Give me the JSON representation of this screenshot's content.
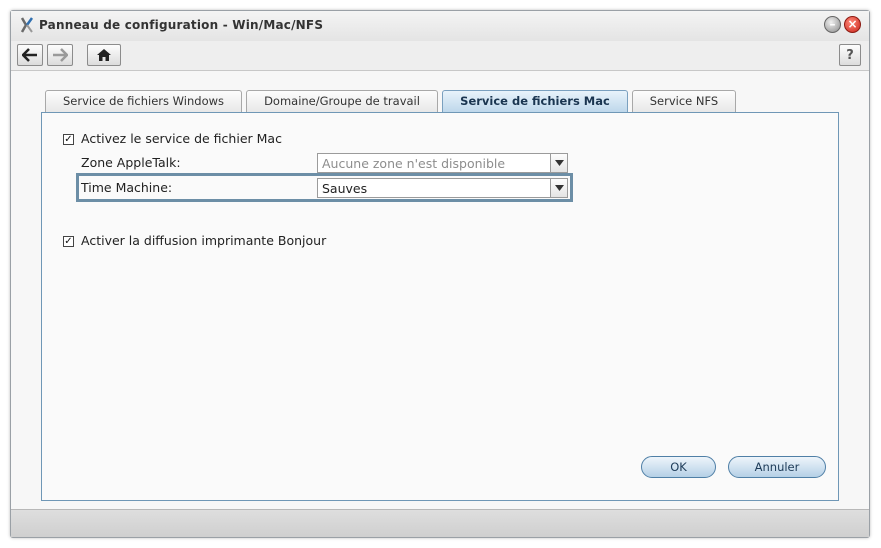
{
  "window": {
    "title": "Panneau de configuration - Win/Mac/NFS"
  },
  "toolbar": {
    "help_label": "?"
  },
  "tabs": [
    {
      "label": "Service de fichiers Windows",
      "active": false
    },
    {
      "label": "Domaine/Groupe de travail",
      "active": false
    },
    {
      "label": "Service de fichiers Mac",
      "active": true
    },
    {
      "label": "Service NFS",
      "active": false
    }
  ],
  "form": {
    "enable_mac": {
      "label": "Activez le service de fichier Mac",
      "checked": true
    },
    "appletalk": {
      "label": "Zone AppleTalk:",
      "value": "Aucune zone n'est disponible",
      "disabled": true
    },
    "time_machine": {
      "label": "Time Machine:",
      "value": "Sauves"
    },
    "bonjour": {
      "label": "Activer la diffusion imprimante Bonjour",
      "checked": true
    }
  },
  "buttons": {
    "ok": "OK",
    "cancel": "Annuler"
  },
  "icons": {
    "app": "synology-tools-icon",
    "back": "arrow-left-icon",
    "forward": "arrow-right-icon",
    "home": "home-icon",
    "minimize": "minimize-icon",
    "close": "close-icon"
  }
}
